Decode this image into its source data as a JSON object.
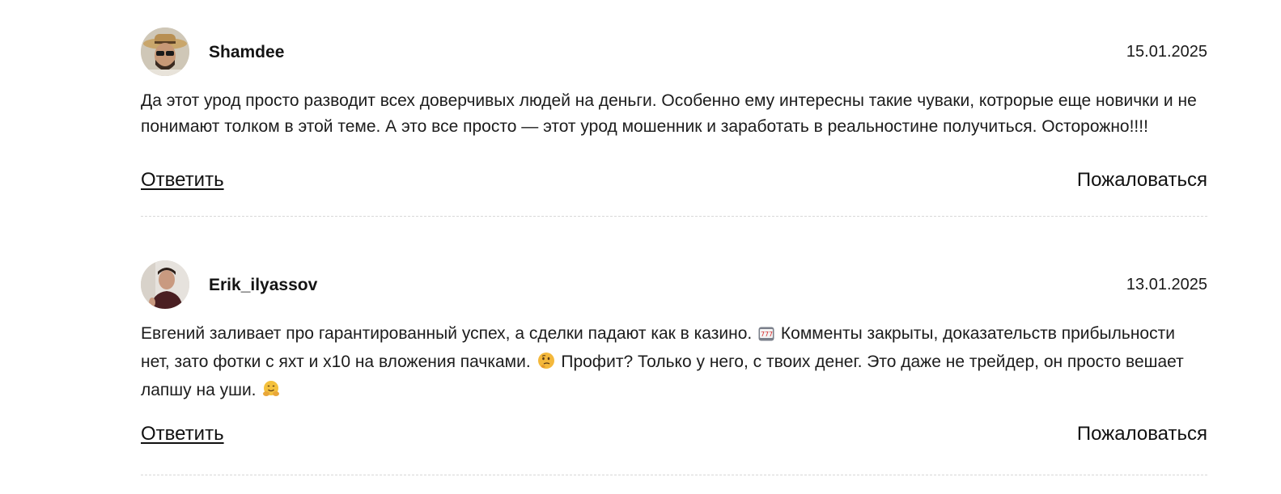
{
  "comments": [
    {
      "username": "Shamdee",
      "date": "15.01.2025",
      "text": "Да этот урод просто разводит всех доверчивых людей на деньги. Особенно ему интересны такие чуваки, котрорые еще новички и не понимают толком в этой теме. А это все просто — этот урод мошенник и заработать в реальностине получиться. Осторожно!!!!",
      "reply_label": "Ответить",
      "report_label": "Пожаловаться"
    },
    {
      "username": "Erik_ilyassov",
      "date": "13.01.2025",
      "text_part1": "Евгений заливает про гарантированный успех, а сделки падают как в казино.",
      "text_part2": "Комменты закрыты, доказательств прибыльности нет, зато фотки с яхт и х10 на вложения пачками.",
      "text_part3": "Профит? Только у него, с твоих денег. Это даже не трейдер, он просто вешает лапшу на уши.",
      "reply_label": "Ответить",
      "report_label": "Пожаловаться"
    }
  ],
  "icons": {
    "slot_machine": "slot-machine-emoji",
    "thinking": "thinking-face-emoji",
    "hugging": "hugging-face-emoji"
  }
}
